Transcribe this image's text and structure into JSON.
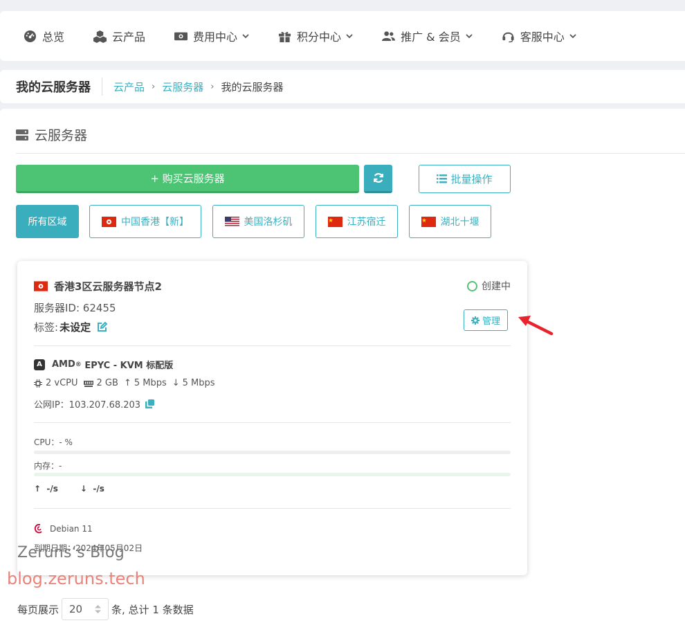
{
  "nav": {
    "items": [
      {
        "label": "总览",
        "icon": "dashboard-icon"
      },
      {
        "label": "云产品",
        "icon": "cubes-icon"
      },
      {
        "label": "费用中心",
        "icon": "money-icon"
      },
      {
        "label": "积分中心",
        "icon": "gift-icon"
      },
      {
        "label": "推广 & 会员",
        "icon": "users-icon"
      },
      {
        "label": "客服中心",
        "icon": "headset-icon"
      }
    ]
  },
  "breadcrumb": {
    "title": "我的云服务器",
    "links": [
      "云产品",
      "云服务器"
    ],
    "current": "我的云服务器"
  },
  "panel": {
    "title": "云服务器",
    "buy_label": "+ 购买云服务器",
    "batch_label": "批量操作"
  },
  "regions": [
    {
      "label": "所有区域",
      "flag": ""
    },
    {
      "label": "中国香港【新】",
      "flag": "hk"
    },
    {
      "label": "美国洛杉矶",
      "flag": "us"
    },
    {
      "label": "江苏宿迁",
      "flag": "cn"
    },
    {
      "label": "湖北十堰",
      "flag": "cn"
    }
  ],
  "server": {
    "name": "香港3区云服务器节点2",
    "id_text": "服务器ID: 62455",
    "tag_label": "标签:",
    "tag_value": "未设定",
    "status": "创建中",
    "manage_label": "管理",
    "cpu_brand": "AMD",
    "cpu_rest": " EPYC - KVM 标配版",
    "vcpu": "2 vCPU",
    "ram": "2 GB",
    "up_bw": "5 Mbps",
    "down_bw": "5 Mbps",
    "ip_text": "公网IP：103.207.68.203",
    "cpu_label": "CPU：- %",
    "mem_label": "内存：-",
    "cpu_usage": 0,
    "mem_usage": 0,
    "up_speed": "↑  -/s",
    "down_speed": "↓  -/s",
    "os": "Debian 11",
    "expire": "到期日期：2024年05月02日"
  },
  "watermark": {
    "line1": "Zeruns‘s Blog",
    "line2": "blog.zeruns.tech"
  },
  "pager": {
    "prefix": "每页展示",
    "page_size": "20",
    "suffix": "条, 总计 1 条数据"
  },
  "colors": {
    "accent": "#3bb0c0",
    "buy_green": "#4cc473",
    "status_green": "#4cc473"
  }
}
